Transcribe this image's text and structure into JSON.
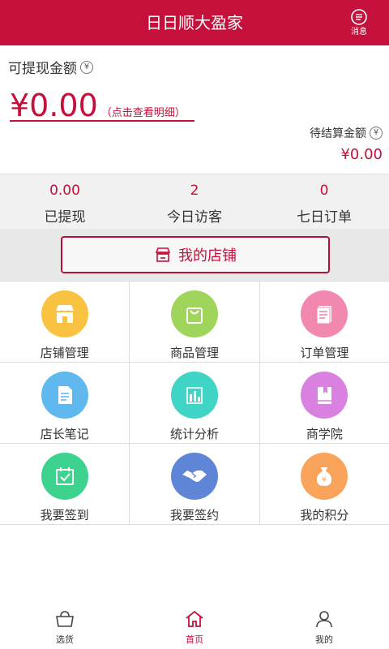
{
  "header": {
    "title": "日日顺大盈家",
    "message_label": "消息"
  },
  "balance": {
    "withdrawable_label": "可提现金额",
    "amount": "¥0.00",
    "detail_link": "（点击查看明细）",
    "pending_label": "待结算金额",
    "pending_amount": "¥0.00",
    "yen_symbol": "¥"
  },
  "stats": [
    {
      "value": "0.00",
      "label": "已提现"
    },
    {
      "value": "2",
      "label": "今日访客"
    },
    {
      "value": "0",
      "label": "七日订单"
    }
  ],
  "shop_button": {
    "label": "我的店铺"
  },
  "grid": [
    {
      "label": "店铺管理",
      "icon": "storefront-icon",
      "color": "#f9c341"
    },
    {
      "label": "商品管理",
      "icon": "shopping-bag-icon",
      "color": "#9fd55a"
    },
    {
      "label": "订单管理",
      "icon": "document-icon",
      "color": "#f287b0"
    },
    {
      "label": "店长笔记",
      "icon": "notepad-icon",
      "color": "#5fb9ee"
    },
    {
      "label": "统计分析",
      "icon": "bar-chart-icon",
      "color": "#3fd4c6"
    },
    {
      "label": "商学院",
      "icon": "book-icon",
      "color": "#d881e0"
    },
    {
      "label": "我要签到",
      "icon": "calendar-check-icon",
      "color": "#3dd38e"
    },
    {
      "label": "我要签约",
      "icon": "handshake-icon",
      "color": "#5f86d6"
    },
    {
      "label": "我的积分",
      "icon": "money-bag-icon",
      "color": "#f9a35b"
    }
  ],
  "tabs": [
    {
      "label": "选货",
      "icon": "basket-icon",
      "active": false
    },
    {
      "label": "首页",
      "icon": "home-icon",
      "active": true
    },
    {
      "label": "我的",
      "icon": "person-icon",
      "active": false
    }
  ],
  "colors": {
    "brand": "#c4103a",
    "stats_bg": "#f1f1f1"
  }
}
